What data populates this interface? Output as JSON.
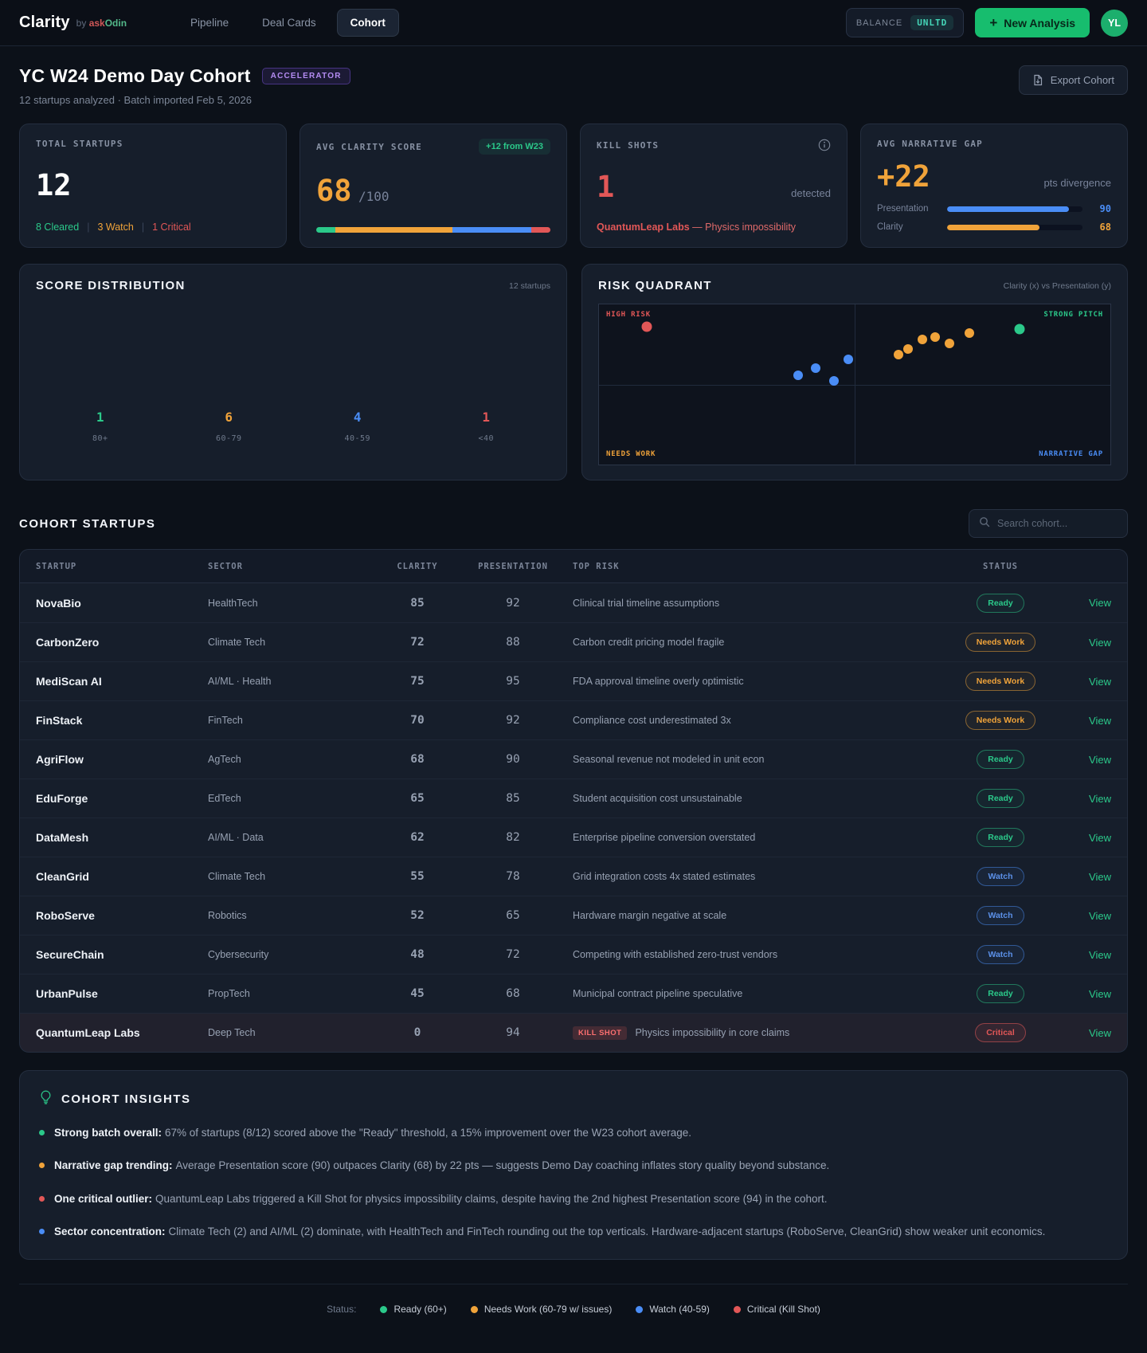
{
  "app": {
    "logo": "Clarity",
    "logo_by": "by",
    "logo_brand_ask": "ask",
    "logo_brand_odin": "Odin",
    "nav": [
      {
        "label": "Pipeline",
        "active": false
      },
      {
        "label": "Deal Cards",
        "active": false
      },
      {
        "label": "Cohort",
        "active": true
      }
    ],
    "balance_label": "BALANCE",
    "balance_value": "UNLTD",
    "new_analysis_plus": "+",
    "new_analysis_label": "New Analysis",
    "avatar_initials": "YL"
  },
  "page": {
    "title": "YC W24 Demo Day Cohort",
    "badge": "ACCELERATOR",
    "subtitle": "12 startups analyzed · Batch imported Feb 5, 2026",
    "export_label": "Export Cohort"
  },
  "stats": {
    "total": {
      "label": "TOTAL STARTUPS",
      "value": "12",
      "cleared": "8 Cleared",
      "watch": "3 Watch",
      "critical": "1 Critical",
      "sep": "|"
    },
    "clarity": {
      "label": "AVG CLARITY SCORE",
      "badge": "+12 from W23",
      "value": "68",
      "denom": "/100",
      "segments": [
        {
          "color": "#2bc98a",
          "pct": 8.3
        },
        {
          "color": "#f0a33a",
          "pct": 50
        },
        {
          "color": "#4a8df6",
          "pct": 33.4
        },
        {
          "color": "#e25757",
          "pct": 8.3
        }
      ]
    },
    "killshots": {
      "label": "KILL SHOTS",
      "value": "1",
      "suffix": "detected",
      "detail_name": "QuantumLeap Labs",
      "detail_rest": "— Physics impossibility"
    },
    "gap": {
      "label": "AVG NARRATIVE GAP",
      "value": "+22",
      "suffix": "pts divergence",
      "bars": [
        {
          "label": "Presentation",
          "value": 90,
          "color": "#4a8df6"
        },
        {
          "label": "Clarity",
          "value": 68,
          "color": "#f0a33a"
        }
      ]
    }
  },
  "distribution": {
    "title": "SCORE DISTRIBUTION",
    "meta": "12 startups",
    "buckets": [
      {
        "count": "1",
        "range": "80+",
        "color": "#2bc98a"
      },
      {
        "count": "6",
        "range": "60-79",
        "color": "#f0a33a"
      },
      {
        "count": "4",
        "range": "40-59",
        "color": "#4a8df6"
      },
      {
        "count": "1",
        "range": "<40",
        "color": "#e25757"
      }
    ]
  },
  "quadrant": {
    "title": "RISK QUADRANT",
    "meta": "Clarity (x) vs Presentation (y)",
    "corners": {
      "top_left": "HIGH RISK",
      "top_right": "STRONG PITCH",
      "bottom_left": "NEEDS WORK",
      "bottom_right": "NARRATIVE GAP"
    },
    "points": [
      {
        "name": "QuantumLeap Labs",
        "color": "#e25757",
        "x": 9.3,
        "y": 13.8,
        "size": 13
      },
      {
        "name": "UrbanPulse",
        "color": "#4a8df6",
        "x": 38.9,
        "y": 44.1,
        "size": 12
      },
      {
        "name": "SecureChain",
        "color": "#4a8df6",
        "x": 42.4,
        "y": 39.7,
        "size": 12
      },
      {
        "name": "RoboServe",
        "color": "#4a8df6",
        "x": 46.0,
        "y": 47.9,
        "size": 12
      },
      {
        "name": "CleanGrid",
        "color": "#4a8df6",
        "x": 48.7,
        "y": 34.3,
        "size": 12
      },
      {
        "name": "DataMesh",
        "color": "#f0a33a",
        "x": 58.6,
        "y": 31.1,
        "size": 12
      },
      {
        "name": "EduForge",
        "color": "#f0a33a",
        "x": 60.5,
        "y": 27.8,
        "size": 12
      },
      {
        "name": "AgriFlow",
        "color": "#f0a33a",
        "x": 63.3,
        "y": 21.9,
        "size": 12
      },
      {
        "name": "FinStack",
        "color": "#f0a33a",
        "x": 65.7,
        "y": 20.3,
        "size": 12
      },
      {
        "name": "CarbonZero",
        "color": "#f0a33a",
        "x": 68.6,
        "y": 24.6,
        "size": 12
      },
      {
        "name": "MediScan AI",
        "color": "#f0a33a",
        "x": 72.5,
        "y": 18.1,
        "size": 12
      },
      {
        "name": "NovaBio",
        "color": "#2bc98a",
        "x": 82.3,
        "y": 15.4,
        "size": 13
      }
    ]
  },
  "cohort": {
    "heading": "COHORT STARTUPS",
    "search_placeholder": "Search cohort..."
  },
  "table": {
    "columns": [
      "STARTUP",
      "SECTOR",
      "CLARITY",
      "PRESENTATION",
      "TOP RISK",
      "STATUS"
    ],
    "view_label": "View",
    "kill_shot_label": "KILL SHOT",
    "rows": [
      {
        "name": "NovaBio",
        "sector": "HealthTech",
        "clarity": "85",
        "clarity_color": "green",
        "presentation": "92",
        "risk": "Clinical trial timeline assumptions",
        "kill_shot": false,
        "status": "Ready",
        "status_color": "green",
        "highlight": false
      },
      {
        "name": "CarbonZero",
        "sector": "Climate Tech",
        "clarity": "72",
        "clarity_color": "orange",
        "presentation": "88",
        "risk": "Carbon credit pricing model fragile",
        "kill_shot": false,
        "status": "Needs Work",
        "status_color": "orange",
        "highlight": false
      },
      {
        "name": "MediScan AI",
        "sector": "AI/ML · Health",
        "clarity": "75",
        "clarity_color": "orange",
        "presentation": "95",
        "risk": "FDA approval timeline overly optimistic",
        "kill_shot": false,
        "status": "Needs Work",
        "status_color": "orange",
        "highlight": false
      },
      {
        "name": "FinStack",
        "sector": "FinTech",
        "clarity": "70",
        "clarity_color": "orange",
        "presentation": "92",
        "risk": "Compliance cost underestimated 3x",
        "kill_shot": false,
        "status": "Needs Work",
        "status_color": "orange",
        "highlight": false
      },
      {
        "name": "AgriFlow",
        "sector": "AgTech",
        "clarity": "68",
        "clarity_color": "orange",
        "presentation": "90",
        "risk": "Seasonal revenue not modeled in unit econ",
        "kill_shot": false,
        "status": "Ready",
        "status_color": "green",
        "highlight": false
      },
      {
        "name": "EduForge",
        "sector": "EdTech",
        "clarity": "65",
        "clarity_color": "orange",
        "presentation": "85",
        "risk": "Student acquisition cost unsustainable",
        "kill_shot": false,
        "status": "Ready",
        "status_color": "green",
        "highlight": false
      },
      {
        "name": "DataMesh",
        "sector": "AI/ML · Data",
        "clarity": "62",
        "clarity_color": "orange",
        "presentation": "82",
        "risk": "Enterprise pipeline conversion overstated",
        "kill_shot": false,
        "status": "Ready",
        "status_color": "green",
        "highlight": false
      },
      {
        "name": "CleanGrid",
        "sector": "Climate Tech",
        "clarity": "55",
        "clarity_color": "blue",
        "presentation": "78",
        "risk": "Grid integration costs 4x stated estimates",
        "kill_shot": false,
        "status": "Watch",
        "status_color": "blue",
        "highlight": false
      },
      {
        "name": "RoboServe",
        "sector": "Robotics",
        "clarity": "52",
        "clarity_color": "blue",
        "presentation": "65",
        "risk": "Hardware margin negative at scale",
        "kill_shot": false,
        "status": "Watch",
        "status_color": "blue",
        "highlight": false
      },
      {
        "name": "SecureChain",
        "sector": "Cybersecurity",
        "clarity": "48",
        "clarity_color": "blue",
        "presentation": "72",
        "risk": "Competing with established zero-trust vendors",
        "kill_shot": false,
        "status": "Watch",
        "status_color": "blue",
        "highlight": false
      },
      {
        "name": "UrbanPulse",
        "sector": "PropTech",
        "clarity": "45",
        "clarity_color": "blue",
        "presentation": "68",
        "risk": "Municipal contract pipeline speculative",
        "kill_shot": false,
        "status": "Ready",
        "status_color": "green",
        "highlight": false
      },
      {
        "name": "QuantumLeap Labs",
        "sector": "Deep Tech",
        "clarity": "0",
        "clarity_color": "red",
        "presentation": "94",
        "risk": "Physics impossibility in core claims",
        "kill_shot": true,
        "status": "Critical",
        "status_color": "red",
        "highlight": true
      }
    ]
  },
  "insights": {
    "title": "COHORT INSIGHTS",
    "items": [
      {
        "color": "#2bc98a",
        "label": "Strong batch overall:",
        "text": "67% of startups (8/12) scored above the \"Ready\" threshold, a 15% improvement over the W23 cohort average."
      },
      {
        "color": "#f0a33a",
        "label": "Narrative gap trending:",
        "text": "Average Presentation score (90) outpaces Clarity (68) by 22 pts — suggests Demo Day coaching inflates story quality beyond substance."
      },
      {
        "color": "#e25757",
        "label": "One critical outlier:",
        "text": "QuantumLeap Labs triggered a Kill Shot for physics impossibility claims, despite having the 2nd highest Presentation score (94) in the cohort."
      },
      {
        "color": "#4a8df6",
        "label": "Sector concentration:",
        "text": "Climate Tech (2) and AI/ML (2) dominate, with HealthTech and FinTech rounding out the top verticals. Hardware-adjacent startups (RoboServe, CleanGrid) show weaker unit economics."
      }
    ]
  },
  "footer": {
    "label": "Status:",
    "legend": [
      {
        "color": "#2bc98a",
        "label": "Ready (60+)"
      },
      {
        "color": "#f0a33a",
        "label": "Needs Work (60-79 w/ issues)"
      },
      {
        "color": "#4a8df6",
        "label": "Watch (40-59)"
      },
      {
        "color": "#e25757",
        "label": "Critical (Kill Shot)"
      }
    ]
  },
  "chart_data": [
    {
      "type": "bar",
      "title": "SCORE DISTRIBUTION",
      "categories": [
        "80+",
        "60-79",
        "40-59",
        "<40"
      ],
      "values": [
        1,
        6,
        4,
        1
      ],
      "series_colors": [
        "#2bc98a",
        "#f0a33a",
        "#4a8df6",
        "#e25757"
      ],
      "xlabel": "",
      "ylabel": "",
      "annotation": "12 startups"
    },
    {
      "type": "scatter",
      "title": "RISK QUADRANT",
      "xlabel": "Clarity",
      "ylabel": "Presentation",
      "quadrant_labels": [
        "HIGH RISK",
        "STRONG PITCH",
        "NEEDS WORK",
        "NARRATIVE GAP"
      ],
      "series": [
        {
          "name": "Ready",
          "color": "#2bc98a",
          "points": [
            {
              "label": "NovaBio",
              "x": 85,
              "y": 92
            }
          ]
        },
        {
          "name": "Needs Work",
          "color": "#f0a33a",
          "points": [
            {
              "label": "DataMesh",
              "x": 62,
              "y": 82
            },
            {
              "label": "EduForge",
              "x": 65,
              "y": 85
            },
            {
              "label": "AgriFlow",
              "x": 68,
              "y": 90
            },
            {
              "label": "FinStack",
              "x": 70,
              "y": 92
            },
            {
              "label": "CarbonZero",
              "x": 72,
              "y": 88
            },
            {
              "label": "MediScan AI",
              "x": 75,
              "y": 95
            }
          ]
        },
        {
          "name": "Watch",
          "color": "#4a8df6",
          "points": [
            {
              "label": "UrbanPulse",
              "x": 45,
              "y": 68
            },
            {
              "label": "SecureChain",
              "x": 48,
              "y": 72
            },
            {
              "label": "RoboServe",
              "x": 52,
              "y": 65
            },
            {
              "label": "CleanGrid",
              "x": 55,
              "y": 78
            }
          ]
        },
        {
          "name": "Critical",
          "color": "#e25757",
          "points": [
            {
              "label": "QuantumLeap Labs",
              "x": 0,
              "y": 94
            }
          ]
        }
      ]
    }
  ]
}
